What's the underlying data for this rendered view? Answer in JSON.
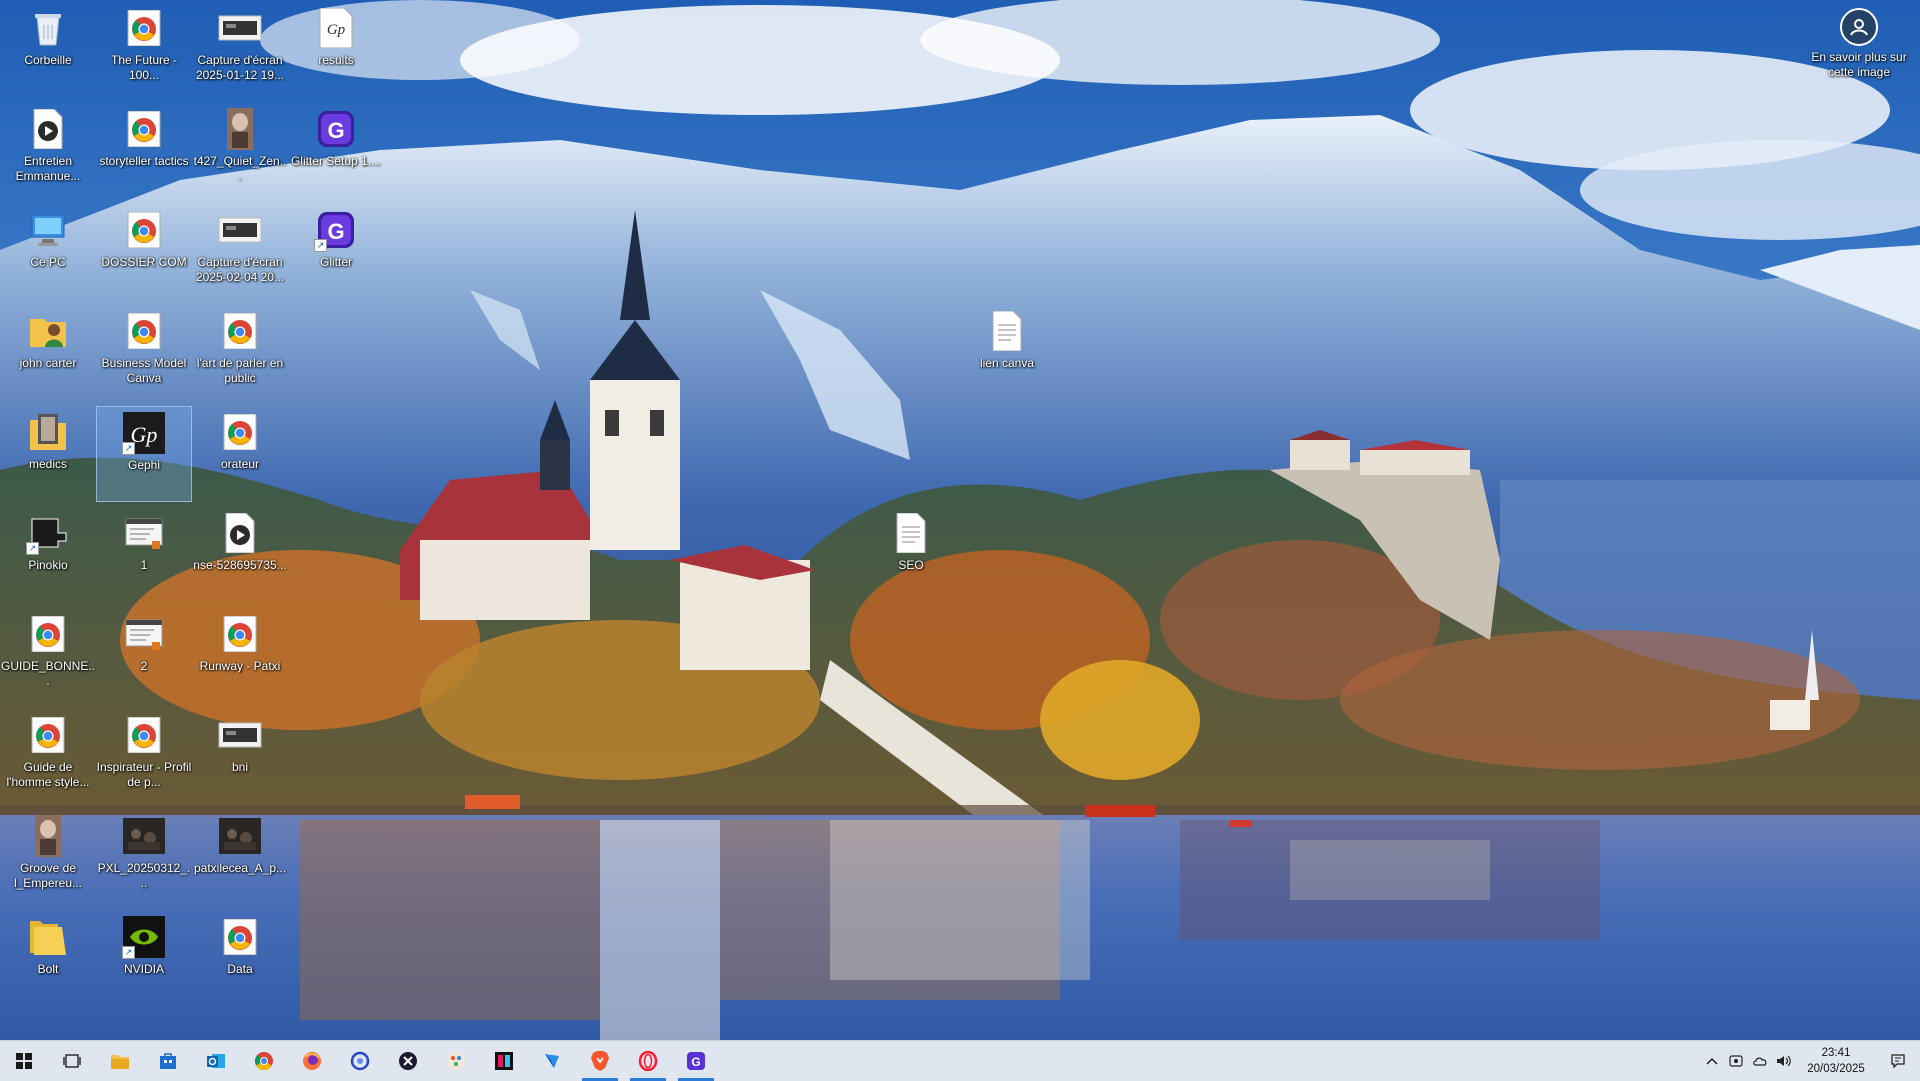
{
  "desktop": {
    "icons": [
      {
        "label": "Corbeille",
        "icon": "recycle-bin-icon"
      },
      {
        "label": "The Future - 100...",
        "icon": "chrome-icon"
      },
      {
        "label": "Capture d'écran 2025-01-12 19...",
        "icon": "screenshot-icon"
      },
      {
        "label": "results",
        "icon": "gephi-doc-icon"
      },
      {
        "label": "Entretien Emmanue...",
        "icon": "media-icon"
      },
      {
        "label": "storyteller tactics",
        "icon": "chrome-icon"
      },
      {
        "label": "t427_Quiet_Zen...",
        "icon": "image-icon"
      },
      {
        "label": "Glitter Setup 1....",
        "icon": "glitter-icon"
      },
      {
        "label": "Ce PC",
        "icon": "computer-icon"
      },
      {
        "label": "DOSSIER COM",
        "icon": "chrome-icon"
      },
      {
        "label": "Capture d'écran 2025-02-04 20...",
        "icon": "screenshot-icon"
      },
      {
        "label": "Glitter",
        "icon": "glitter-icon"
      },
      {
        "label": "john carter",
        "icon": "user-folder-icon"
      },
      {
        "label": "Business Model Canva",
        "icon": "chrome-icon"
      },
      {
        "label": "l'art de parler en public",
        "icon": "chrome-icon"
      },
      {
        "label": "lien canva",
        "icon": "text-file-icon"
      },
      {
        "label": "medics",
        "icon": "image-folder-icon"
      },
      {
        "label": "Gephi",
        "icon": "gephi-icon"
      },
      {
        "label": "orateur",
        "icon": "chrome-icon"
      },
      {
        "label": "Pinokio",
        "icon": "pinokio-icon"
      },
      {
        "label": "1",
        "icon": "window-file-icon"
      },
      {
        "label": "nse-528695735...",
        "icon": "media-icon"
      },
      {
        "label": "SEO",
        "icon": "text-file-icon"
      },
      {
        "label": "GUIDE_BONNE...",
        "icon": "chrome-icon"
      },
      {
        "label": "2",
        "icon": "window-file-icon"
      },
      {
        "label": "Runway - Patxi",
        "icon": "chrome-icon"
      },
      {
        "label": "Guide de l'homme style...",
        "icon": "chrome-icon"
      },
      {
        "label": "Inspirateur - Profil de p...",
        "icon": "chrome-icon"
      },
      {
        "label": "bni",
        "icon": "screenshot-icon"
      },
      {
        "label": "Groove de l_Empereu...",
        "icon": "image-icon"
      },
      {
        "label": "PXL_20250312_...",
        "icon": "photo-icon"
      },
      {
        "label": "patxilecea_A_p...",
        "icon": "photo-icon"
      },
      {
        "label": "Bolt",
        "icon": "folder-icon"
      },
      {
        "label": "NVIDIA",
        "icon": "nvidia-icon"
      },
      {
        "label": "Data",
        "icon": "chrome-icon"
      }
    ],
    "spotlight_label": "En savoir plus sur cette image"
  },
  "taskbar": {
    "apps": [
      "windows-start-icon",
      "task-view-icon",
      "file-explorer-icon",
      "store-icon",
      "outlook-icon",
      "chrome-icon",
      "firefox-icon",
      "cortana-icon",
      "dev-app-icon",
      "paint-app-icon",
      "slack-like-icon",
      "kite-app-icon",
      "brave-icon",
      "opera-icon",
      "glitter-taskbar-icon"
    ],
    "running": [
      "brave-icon",
      "opera-icon",
      "glitter-taskbar-icon"
    ],
    "time": "23:41",
    "date": "20/03/2025"
  },
  "colors": {
    "taskbar_bg": "#dfe6ef",
    "accent": "#2f7bd6",
    "sky": "#2c6fbd"
  }
}
